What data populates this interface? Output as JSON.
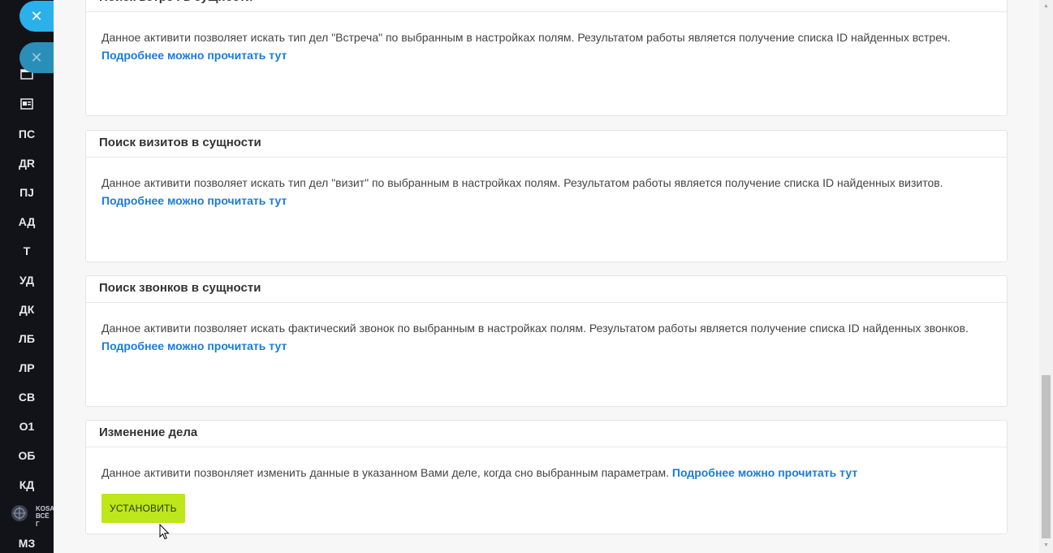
{
  "sidebar": {
    "items": [
      "ПС",
      "ДR",
      "ПJ",
      "АД",
      "Т",
      "УД",
      "ДК",
      "ЛБ",
      "ЛР",
      "СВ",
      "О1",
      "ОБ",
      "КД",
      "МЗ"
    ],
    "icons": [
      "calendar-icon",
      "contact-card-icon"
    ],
    "logo_text_1": "KOSA",
    "logo_text_2": "ВСЁ Г"
  },
  "overlay": {
    "close_symbol": "✕"
  },
  "cards": [
    {
      "title": "Поиск встреч в сущности",
      "text": "Данное активити позволяет искать тип дел \"Встреча\" по выбранным в настройках полям. Результатом работы является получение списка ID найденных встреч. ",
      "link": "Подробнее можно прочитать тут"
    },
    {
      "title": "Поиск визитов в сущности",
      "text": "Данное активити позволяет искать тип дел \"визит\" по выбранным в настройках полям. Результатом работы является получение списка ID найденных визитов. ",
      "link": "Подробнее можно прочитать тут"
    },
    {
      "title": "Поиск звонков в сущности",
      "text": "Данное активити позволяет искать фактический звонок по выбранным в настройках полям. Результатом работы является получение списка ID найденных звонков. ",
      "link": "Подробнее можно прочитать тут"
    },
    {
      "title": "Изменение дела",
      "text": "Данное активити позвонляет изменить данные в указанном Вами деле, когда сно выбранным параметрам. ",
      "link": "Подробнее можно прочитать тут",
      "button": "УСТАНОВИТЬ"
    }
  ],
  "colors": {
    "link": "#1a7bdc",
    "button": "#bde61b",
    "close_button": "#2bb0ea",
    "sidebar": "#111318"
  }
}
